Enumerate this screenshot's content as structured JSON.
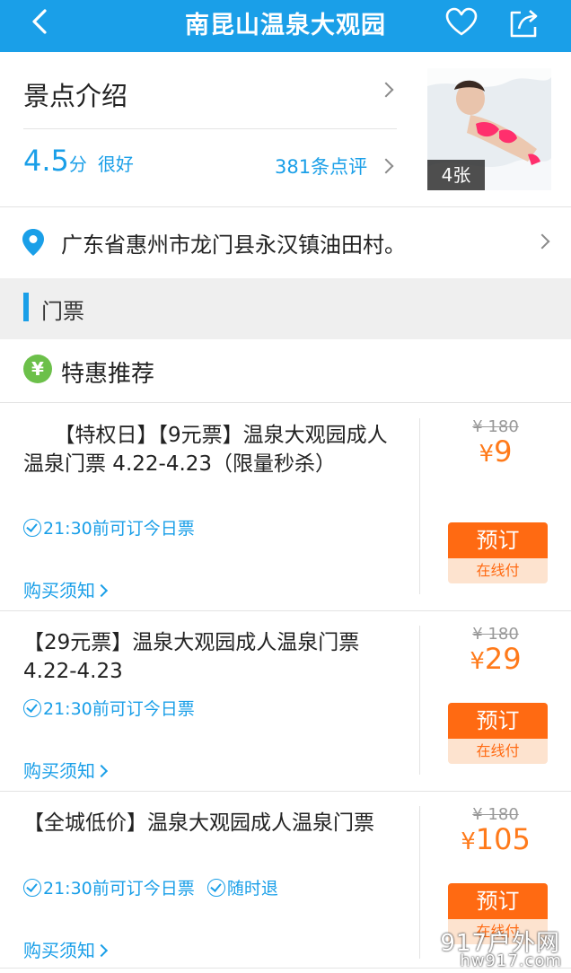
{
  "header": {
    "title": "南昆山温泉大观园",
    "back_icon": "chevron-left-icon",
    "favorite_icon": "heart-icon",
    "share_icon": "share-icon"
  },
  "intro": {
    "title": "景点介绍",
    "score": "4.5",
    "score_unit": "分",
    "score_level": "很好",
    "reviews": "381条点评",
    "photo_count": "4张"
  },
  "address": "广东省惠州市龙门县永汉镇油田村。",
  "tickets_section": {
    "label": "门票"
  },
  "special": {
    "label": "特惠推荐",
    "badge": "¥"
  },
  "tickets": [
    {
      "name": "　　【特权日】【9元票】温泉大观园成人温泉门票 4.22-4.23（限量秒杀）",
      "notes": [
        "21:30前可订今日票"
      ],
      "rules": "购买须知",
      "orig_price": "¥ 180",
      "price_symbol": "¥",
      "price": "9",
      "book_label": "预订",
      "pay_label": "在线付"
    },
    {
      "name": "【29元票】温泉大观园成人温泉门票4.22-4.23",
      "notes": [
        "21:30前可订今日票"
      ],
      "rules": "购买须知",
      "orig_price": "¥ 180",
      "price_symbol": "¥",
      "price": "29",
      "book_label": "预订",
      "pay_label": "在线付"
    },
    {
      "name": "【全城低价】温泉大观园成人温泉门票",
      "notes": [
        "21:30前可订今日票",
        "随时退"
      ],
      "rules": "购买须知",
      "orig_price": "¥ 180",
      "price_symbol": "¥",
      "price": "105",
      "book_label": "预订",
      "pay_label": "在线付"
    }
  ],
  "watermark": {
    "line1": "917户外网",
    "line2": "hw917.com"
  },
  "colors": {
    "primary": "#1a9fe8",
    "accent": "#ff6a12",
    "price": "#ff7a1a"
  }
}
